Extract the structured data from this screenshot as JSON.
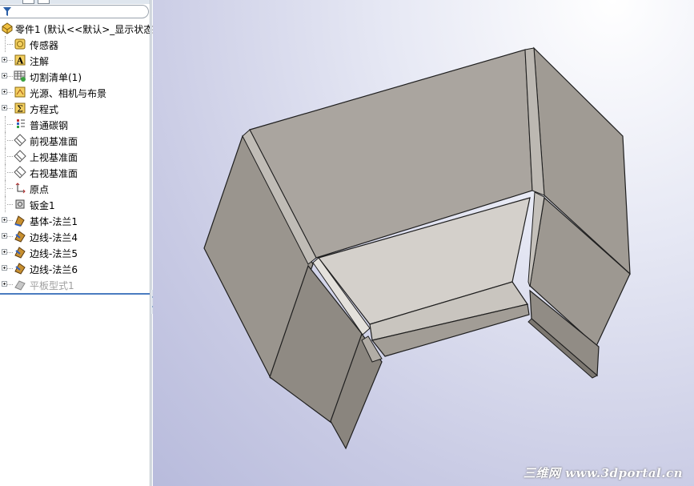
{
  "tree": {
    "root": "零件1 (默认<<默认>_显示状态",
    "items": [
      {
        "label": "传感器",
        "icon": "sensor-icon",
        "expandable": false
      },
      {
        "label": "注解",
        "icon": "annotation-icon",
        "expandable": true
      },
      {
        "label": "切割清单(1)",
        "icon": "cut-list-icon",
        "expandable": true
      },
      {
        "label": "光源、相机与布景",
        "icon": "lights-cameras-icon",
        "expandable": true
      },
      {
        "label": "方程式",
        "icon": "equations-icon",
        "expandable": true
      },
      {
        "label": "普通碳钢",
        "icon": "material-icon",
        "expandable": false
      },
      {
        "label": "前视基准面",
        "icon": "plane-icon",
        "expandable": false
      },
      {
        "label": "上视基准面",
        "icon": "plane-icon",
        "expandable": false
      },
      {
        "label": "右视基准面",
        "icon": "plane-icon",
        "expandable": false
      },
      {
        "label": "原点",
        "icon": "origin-icon",
        "expandable": false
      },
      {
        "label": "钣金1",
        "icon": "sheet-metal-icon",
        "expandable": false
      },
      {
        "label": "基体-法兰1",
        "icon": "base-flange-icon",
        "expandable": true
      },
      {
        "label": "边线-法兰4",
        "icon": "edge-flange-icon",
        "expandable": true
      },
      {
        "label": "边线-法兰5",
        "icon": "edge-flange-icon",
        "expandable": true
      },
      {
        "label": "边线-法兰6",
        "icon": "edge-flange-icon",
        "expandable": true
      },
      {
        "label": "平板型式1",
        "icon": "flat-pattern-icon",
        "expandable": true,
        "suppressed": true
      }
    ]
  },
  "watermark": "三维网 www.3dportal.cn"
}
